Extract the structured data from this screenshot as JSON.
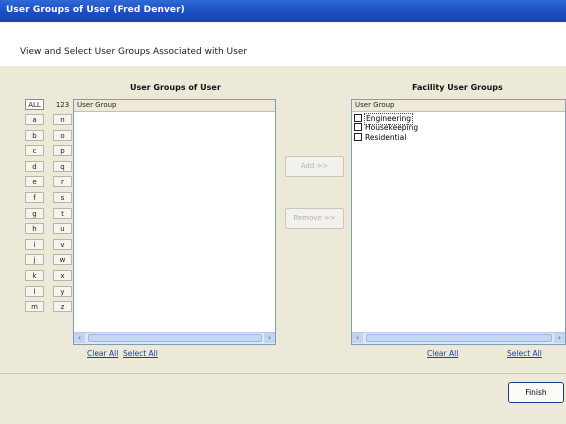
{
  "window": {
    "title": "User Groups of User (Fred Denver)"
  },
  "header": {
    "instruction": "View and Select User Groups Associated with User"
  },
  "left_panel": {
    "title": "User Groups of User",
    "column_header": "User Group",
    "tabs": {
      "all": "ALL",
      "num": "123",
      "col1": [
        "a",
        "b",
        "c",
        "d",
        "e",
        "f",
        "g",
        "h",
        "i",
        "j",
        "k",
        "l",
        "m"
      ],
      "col2": [
        "n",
        "o",
        "p",
        "q",
        "r",
        "s",
        "t",
        "u",
        "v",
        "w",
        "x",
        "y",
        "z"
      ]
    },
    "clear_all": "Clear All",
    "select_all": "Select All"
  },
  "middle": {
    "add_label": "Add >>",
    "remove_label": "Remove >>"
  },
  "right_panel": {
    "title": "Facility User Groups",
    "column_header": "User Group",
    "items": [
      "Engineering",
      "Housekeeping",
      "Residential"
    ],
    "clear_all": "Clear All",
    "select_all": "Select All"
  },
  "footer": {
    "finish_label": "Finish"
  },
  "icons": {
    "scroll_left": "‹",
    "scroll_right": "›"
  },
  "colors": {
    "title_bar": "#1a4ec2",
    "dialog_bg": "#ece9d8",
    "link": "#1a3ea8"
  }
}
